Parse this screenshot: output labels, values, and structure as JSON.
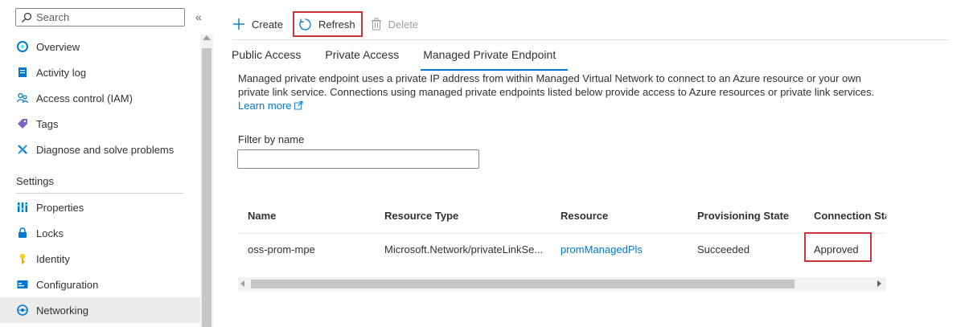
{
  "sidebar": {
    "search_placeholder": "Search",
    "collapse_glyph": "«",
    "items": [
      {
        "label": "Overview",
        "icon": "overview-icon"
      },
      {
        "label": "Activity log",
        "icon": "activity-log-icon"
      },
      {
        "label": "Access control (IAM)",
        "icon": "iam-icon"
      },
      {
        "label": "Tags",
        "icon": "tag-icon"
      },
      {
        "label": "Diagnose and solve problems",
        "icon": "diagnose-icon"
      }
    ],
    "settings_heading": "Settings",
    "settings_items": [
      {
        "label": "Properties",
        "icon": "properties-icon"
      },
      {
        "label": "Locks",
        "icon": "lock-icon"
      },
      {
        "label": "Identity",
        "icon": "identity-icon"
      },
      {
        "label": "Configuration",
        "icon": "configuration-icon"
      },
      {
        "label": "Networking",
        "icon": "networking-icon",
        "active": true
      }
    ]
  },
  "toolbar": {
    "create_label": "Create",
    "refresh_label": "Refresh",
    "delete_label": "Delete"
  },
  "tabs": {
    "public": "Public Access",
    "private": "Private Access",
    "managed": "Managed Private Endpoint",
    "active": "Managed Private Endpoint"
  },
  "description": {
    "text": "Managed private endpoint uses a private IP address from within Managed Virtual Network to connect to an Azure resource or your own private link service. Connections using managed private endpoints listed below provide access to Azure resources or private link services.",
    "learn_more": "Learn more"
  },
  "filter": {
    "label": "Filter by name",
    "value": ""
  },
  "table": {
    "columns": [
      "Name",
      "Resource Type",
      "Resource",
      "Provisioning State",
      "Connection Sta"
    ],
    "rows": [
      {
        "name": "oss-prom-mpe",
        "resource_type": "Microsoft.Network/privateLinkSe...",
        "resource": "promManagedPls",
        "provisioning_state": "Succeeded",
        "connection_state": "Approved"
      }
    ]
  },
  "colors": {
    "accent": "#0078d4",
    "highlight": "#d13438"
  }
}
